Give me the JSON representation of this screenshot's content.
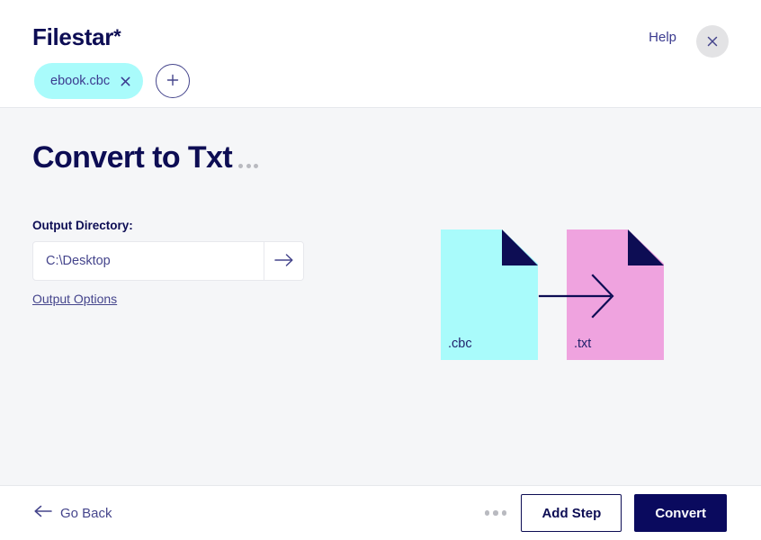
{
  "header": {
    "brand_name": "Filestar",
    "brand_star": "*",
    "help_label": "Help",
    "close_icon": "close-icon",
    "files": [
      {
        "name": "ebook.cbc",
        "remove_icon": "close-icon"
      }
    ],
    "add_file_label": "+",
    "add_file_icon": "plus-icon"
  },
  "main": {
    "title": "Convert to Txt",
    "title_menu_icon": "ellipsis-icon",
    "output_directory_label": "Output Directory:",
    "output_directory_value": "C:\\Desktop",
    "output_directory_placeholder": "C:\\Desktop",
    "directory_go_icon": "arrow-right-icon",
    "output_options_label": "Output Options",
    "graphic": {
      "source_extension": ".cbc",
      "target_extension": ".txt",
      "arrow_icon": "arrow-right-icon",
      "source_color": "#a9fbfb",
      "target_color": "#efa3df",
      "fold_color": "#0d0d54"
    }
  },
  "footer": {
    "go_back_label": "Go Back",
    "go_back_icon": "arrow-left-icon",
    "more_icon": "ellipsis-icon",
    "add_step_label": "Add Step",
    "convert_label": "Convert"
  },
  "theme": {
    "navy": "#0d0d54",
    "primary_button": "#0a0a5e",
    "indigo_text": "#45458c",
    "content_bg": "#f5f6f8",
    "chip_bg": "#a9fbfb"
  }
}
